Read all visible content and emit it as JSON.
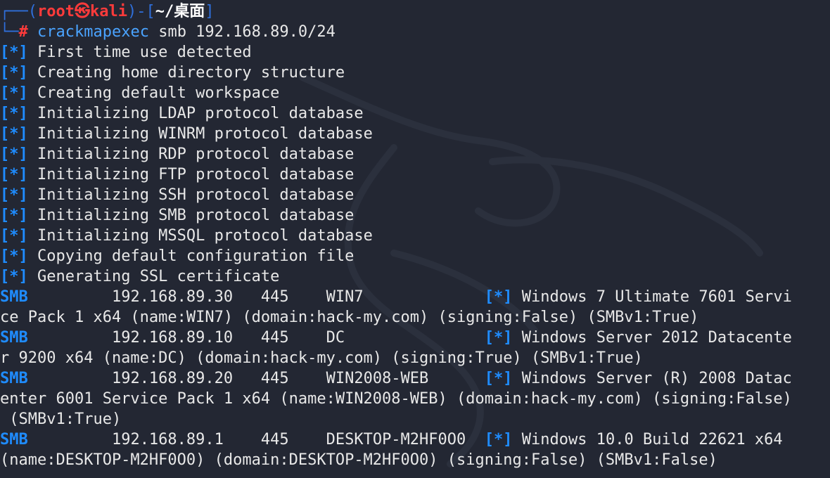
{
  "prompt": {
    "corner_top": "┌──",
    "open": "(",
    "user": "root",
    "at": "㉿",
    "host": "kali",
    "close": ")",
    "sep": "-[",
    "path": "~/桌面",
    "path_close": "]",
    "corner_bottom": "└─",
    "hash": "#"
  },
  "command": {
    "program": "crackmapexec",
    "args": " smb 192.168.89.0/24"
  },
  "info_marker": "[*]",
  "info_lines": [
    "First time use detected",
    "Creating home directory structure",
    "Creating default workspace",
    "Initializing LDAP protocol database",
    "Initializing WINRM protocol database",
    "Initializing RDP protocol database",
    "Initializing FTP protocol database",
    "Initializing SSH protocol database",
    "Initializing SMB protocol database",
    "Initializing MSSQL protocol database",
    "Copying default configuration file",
    "Generating SSL certificate"
  ],
  "smb_results": [
    {
      "proto": "SMB",
      "head": "         192.168.89.30   445    WIN7             ",
      "marker": "[*]",
      "tail": " Windows 7 Ultimate 7601 Servi",
      "wraps": [
        "ce Pack 1 x64 (name:WIN7) (domain:hack-my.com) (signing:False) (SMBv1:True)"
      ]
    },
    {
      "proto": "SMB",
      "head": "         192.168.89.10   445    DC               ",
      "marker": "[*]",
      "tail": " Windows Server 2012 Datacente",
      "wraps": [
        "r 9200 x64 (name:DC) (domain:hack-my.com) (signing:True) (SMBv1:True)"
      ]
    },
    {
      "proto": "SMB",
      "head": "         192.168.89.20   445    WIN2008-WEB      ",
      "marker": "[*]",
      "tail": " Windows Server (R) 2008 Datac",
      "wraps": [
        "enter 6001 Service Pack 1 x64 (name:WIN2008-WEB) (domain:hack-my.com) (signing:False)",
        " (SMBv1:True)"
      ]
    },
    {
      "proto": "SMB",
      "head": "         192.168.89.1    445    DESKTOP-M2HF0O0  ",
      "marker": "[*]",
      "tail": " Windows 10.0 Build 22621 x64",
      "wraps": [
        "(name:DESKTOP-M2HF0O0) (domain:DESKTOP-M2HF0O0) (signing:False) (SMBv1:False)"
      ]
    }
  ]
}
